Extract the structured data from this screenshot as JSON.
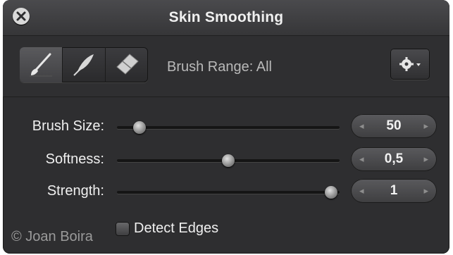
{
  "window": {
    "title": "Skin Smoothing"
  },
  "toolbar": {
    "tools": [
      {
        "icon": "paintbrush-icon",
        "active": true
      },
      {
        "icon": "feather-brush-icon",
        "active": false
      },
      {
        "icon": "eraser-icon",
        "active": false
      }
    ],
    "brush_range_label": "Brush Range: All",
    "gear_icon": "gear-dropdown-icon"
  },
  "controls": [
    {
      "label": "Brush Size:",
      "value": "50",
      "slider_fraction": 0.07
    },
    {
      "label": "Softness:",
      "value": "0,5",
      "slider_fraction": 0.5
    },
    {
      "label": "Strength:",
      "value": "1",
      "slider_fraction": 1.0
    }
  ],
  "stepper_arrows": {
    "left": "◂",
    "right": "▸"
  },
  "detect_edges": {
    "label": "Detect Edges",
    "checked": false
  },
  "watermark": "© Joan Boira"
}
